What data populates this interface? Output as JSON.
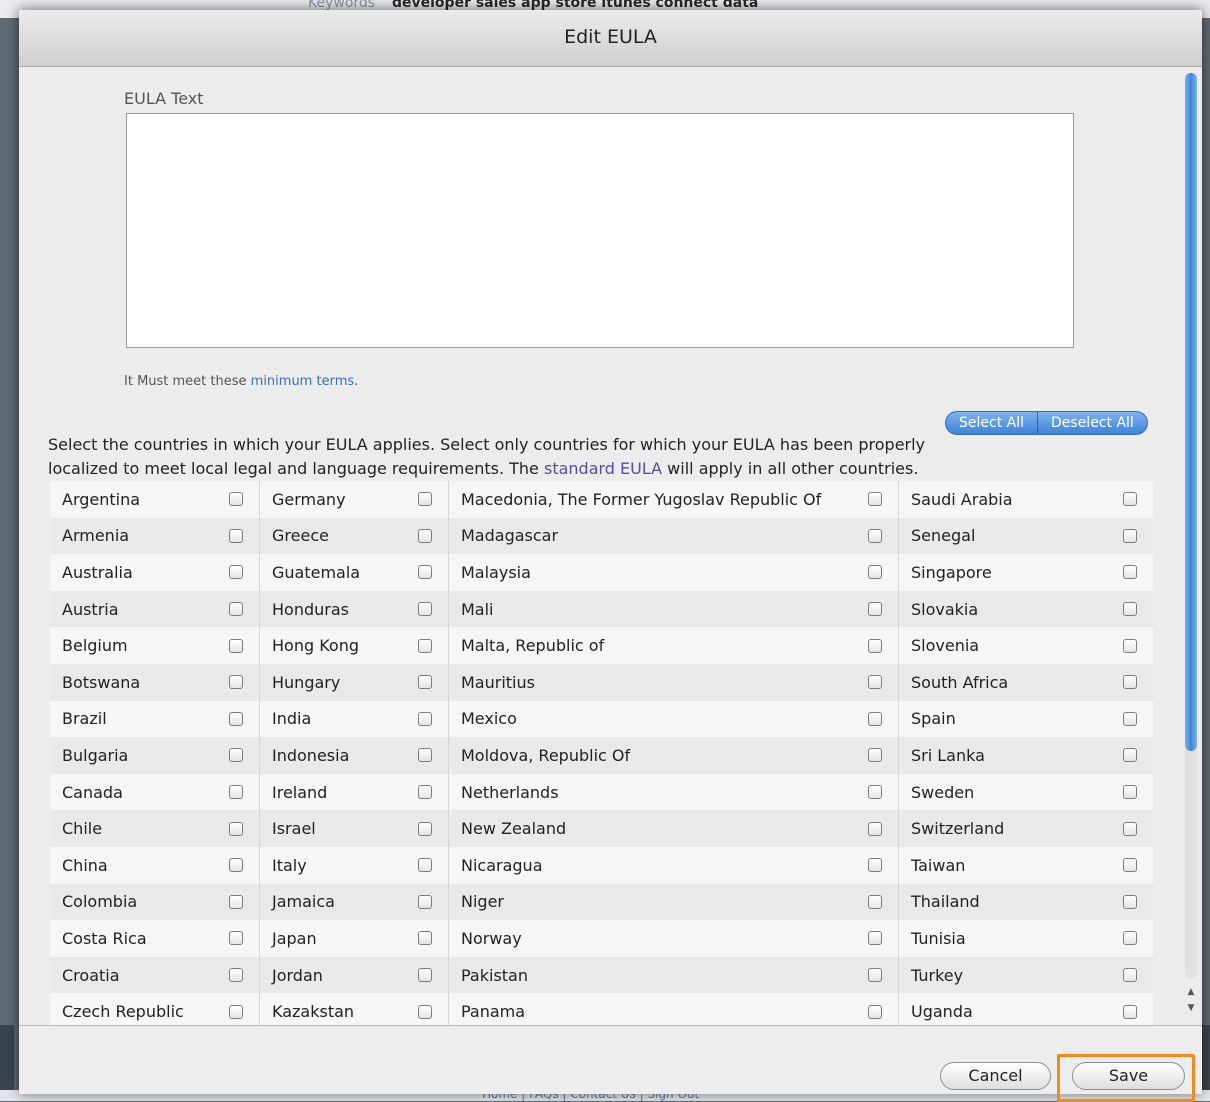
{
  "background": {
    "keywords_label": "Keywords",
    "keywords_value": "developer sales app store itunes connect data",
    "footer_links": "Home | FAQs | Contact Us | Sign Out"
  },
  "dialog": {
    "title": "Edit EULA",
    "eula_label": "EULA Text",
    "eula_value": "",
    "terms_prefix": "It Must meet these ",
    "terms_link": "minimum terms",
    "terms_suffix": ".",
    "select_all": "Select All",
    "deselect_all": "Deselect All",
    "instructions_prefix": "Select the countries in which your EULA applies. Select only countries for which your EULA has been properly localized to meet local legal and language requirements. The ",
    "instructions_link": "standard EULA",
    "instructions_suffix": " will apply in all other countries.",
    "cancel": "Cancel",
    "save": "Save"
  },
  "countries": {
    "col1": [
      "Argentina",
      "Armenia",
      "Australia",
      "Austria",
      "Belgium",
      "Botswana",
      "Brazil",
      "Bulgaria",
      "Canada",
      "Chile",
      "China",
      "Colombia",
      "Costa Rica",
      "Croatia",
      "Czech Republic"
    ],
    "col2": [
      "Germany",
      "Greece",
      "Guatemala",
      "Honduras",
      "Hong Kong",
      "Hungary",
      "India",
      "Indonesia",
      "Ireland",
      "Israel",
      "Italy",
      "Jamaica",
      "Japan",
      "Jordan",
      "Kazakstan"
    ],
    "col3": [
      "Macedonia, The Former Yugoslav Republic Of",
      "Madagascar",
      "Malaysia",
      "Mali",
      "Malta, Republic of",
      "Mauritius",
      "Mexico",
      "Moldova, Republic Of",
      "Netherlands",
      "New Zealand",
      "Nicaragua",
      "Niger",
      "Norway",
      "Pakistan",
      "Panama"
    ],
    "col4": [
      "Saudi Arabia",
      "Senegal",
      "Singapore",
      "Slovakia",
      "Slovenia",
      "South Africa",
      "Spain",
      "Sri Lanka",
      "Sweden",
      "Switzerland",
      "Taiwan",
      "Thailand",
      "Tunisia",
      "Turkey",
      "Uganda"
    ]
  },
  "colors": {
    "accent": "#3f82d6",
    "highlight": "#f08a1c"
  }
}
